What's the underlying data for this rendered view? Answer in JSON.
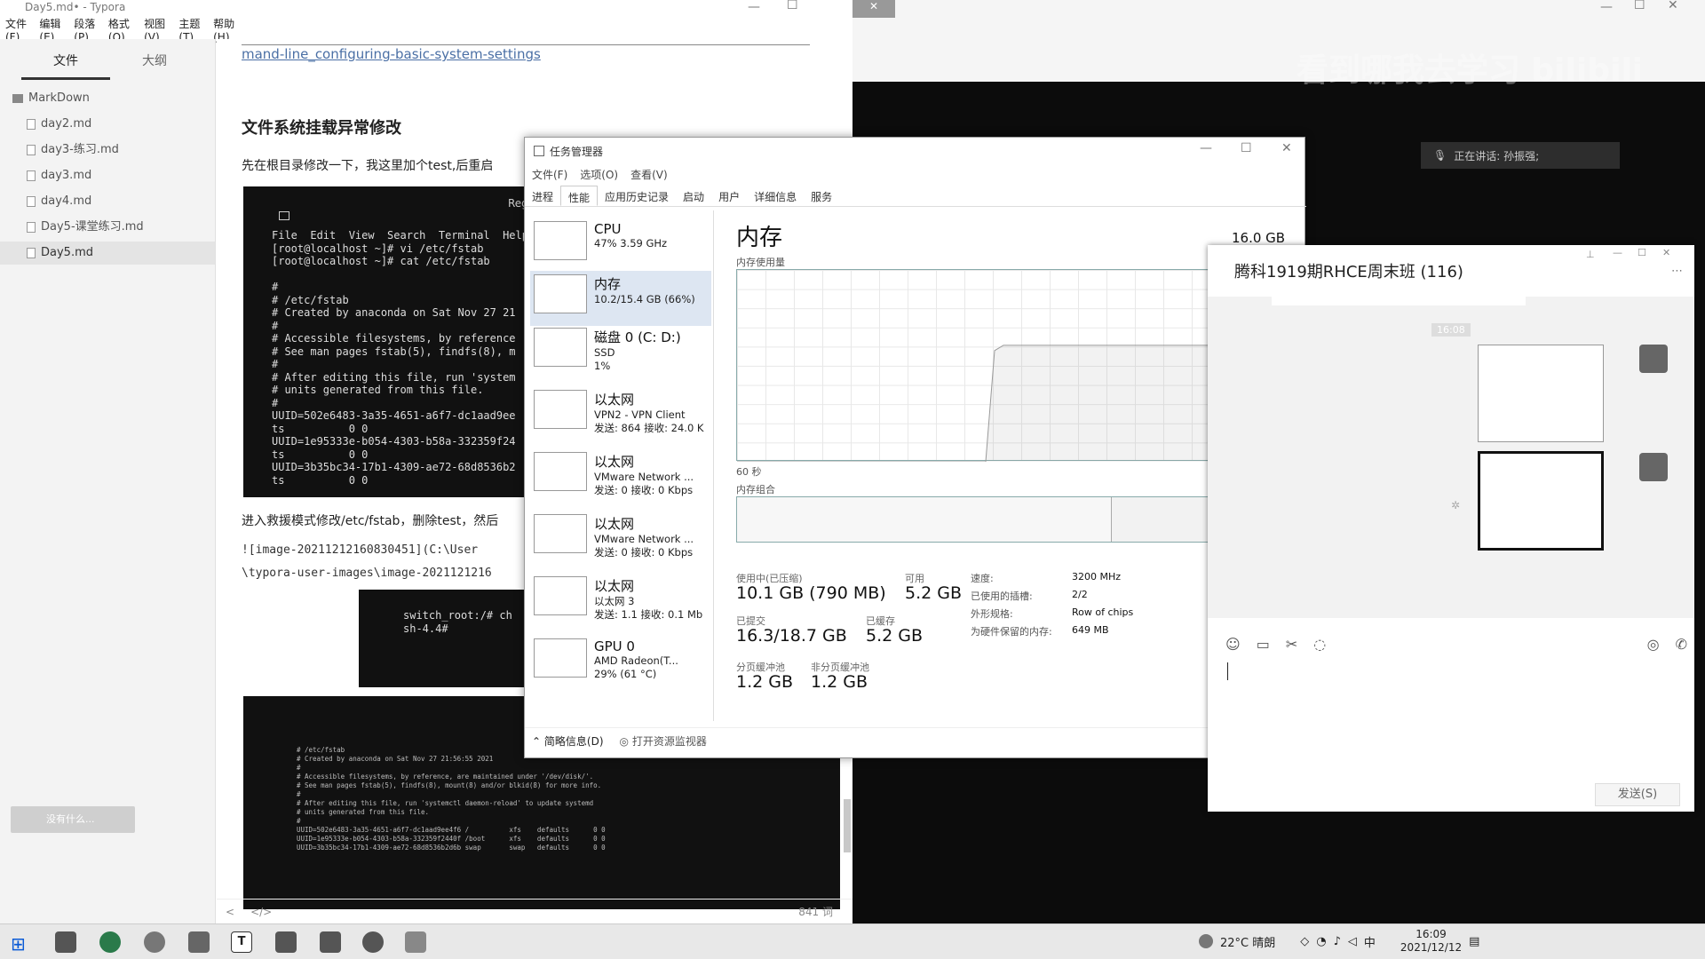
{
  "typora": {
    "title": "Day5.md• - Typora",
    "menu": [
      "文件(F)",
      "编辑(E)",
      "段落(P)",
      "格式(O)",
      "视图(V)",
      "主题(T)",
      "帮助(H)"
    ],
    "sidebar_tabs": [
      "文件",
      "大纲"
    ],
    "folder": "MarkDown",
    "files": [
      "day2.md",
      "day3-练习.md",
      "day3.md",
      "day4.md",
      "Day5-课堂练习.md",
      "Day5.md"
    ],
    "link_text": "mand-line_configuring-basic-system-settings",
    "heading": "文件系统挂载异常修改",
    "para1": "先在根目录修改一下，我这里加个test,后重启",
    "term1": "File  Edit  View  Search  Terminal  Help\n[root@localhost ~]# vi /etc/fstab\n[root@localhost ~]# cat /etc/fstab\n\n#\n# /etc/fstab\n# Created by anaconda on Sat Nov 27 21\n#\n# Accessible filesystems, by reference\n# See man pages fstab(5), findfs(8), m\n#\n# After editing this file, run 'system\n# units generated from this file.\n#\nUUID=502e6483-3a35-4651-a6f7-dc1aad9ee\nts          0 0\nUUID=1e95333e-b054-4303-b58a-332359f24\nts          0 0\nUUID=3b35bc34-17b1-4309-ae72-68d8536b2\nts          0 0",
    "term1_regist": "Regist",
    "para2": "进入救援模式修改/etc/fstab，删除test，然后",
    "img_line1": "![image-20211212160830451](C:\\User",
    "img_line2": "\\typora-user-images\\image-2021121216",
    "term2": "switch_root:/# ch\nsh-4.4#",
    "term3": "# /etc/fstab\n# Created by anaconda on Sat Nov 27 21:56:55 2021\n#\n# Accessible filesystems, by reference, are maintained under '/dev/disk/'.\n# See man pages fstab(5), findfs(8), mount(8) and/or blkid(8) for more info.\n#\n# After editing this file, run 'systemctl daemon-reload' to update systemd\n# units generated from this file.\n#\nUUID=502e6483-3a35-4651-a6f7-dc1aad9ee4f6 /          xfs    defaults      0 0\nUUID=1e95333e-b054-4303-b58a-332359f2440f /boot      xfs    defaults      0 0\nUUID=3b35bc34-17b1-4309-ae72-68d8536b2d6b swap       swap   defaults      0 0",
    "word_count": "841 词",
    "status_left": "<",
    "status_code": "</>",
    "overlay_btn": "没有什么..."
  },
  "browser": {
    "watermark": "看到哪我去学习 bilibili",
    "speaking": "正在讲话: 孙振强;"
  },
  "taskmgr": {
    "title": "任务管理器",
    "menu": [
      "文件(F)",
      "选项(O)",
      "查看(V)"
    ],
    "tabs": [
      "进程",
      "性能",
      "应用历史记录",
      "启动",
      "用户",
      "详细信息",
      "服务"
    ],
    "items": [
      {
        "name": "CPU",
        "sub1": "47% 3.59 GHz",
        "sub2": ""
      },
      {
        "name": "内存",
        "sub1": "10.2/15.4 GB (66%)",
        "sub2": ""
      },
      {
        "name": "磁盘 0 (C: D:)",
        "sub1": "SSD",
        "sub2": "1%"
      },
      {
        "name": "以太网",
        "sub1": "VPN2 - VPN Client",
        "sub2": "发送: 864 接收: 24.0 K"
      },
      {
        "name": "以太网",
        "sub1": "VMware Network ...",
        "sub2": "发送: 0 接收: 0 Kbps"
      },
      {
        "name": "以太网",
        "sub1": "VMware Network ...",
        "sub2": "发送: 0 接收: 0 Kbps"
      },
      {
        "name": "以太网",
        "sub1": "以太网 3",
        "sub2": "发送: 1.1 接收: 0.1 Mb"
      },
      {
        "name": "GPU 0",
        "sub1": "AMD Radeon(T...",
        "sub2": "29% (61 °C)"
      }
    ],
    "mem_title": "内存",
    "mem_total": "16.0 GB",
    "mem_usage_label": "内存使用量",
    "time_label": "60 秒",
    "comp_label": "内存组合",
    "in_use_label": "使用中(已压缩)",
    "in_use": "10.1 GB (790 MB)",
    "avail_label": "可用",
    "avail": "5.2 GB",
    "committed_label": "已提交",
    "committed": "16.3/18.7 GB",
    "cached_label": "已缓存",
    "cached": "5.2 GB",
    "paged_label": "分页缓冲池",
    "paged": "1.2 GB",
    "nonpaged_label": "非分页缓冲池",
    "nonpaged": "1.2 GB",
    "speed_label": "速度:",
    "speed": "3200 MHz",
    "slots_label": "已使用的插槽:",
    "slots": "2/2",
    "form_label": "外形规格:",
    "form": "Row of chips",
    "reserved_label": "为硬件保留的内存:",
    "reserved": "649 MB",
    "foot_less": "简略信息(D)",
    "foot_open": "打开资源监视器",
    "mem_usage_fraction": 0.66
  },
  "chat": {
    "title": "腾科1919期RHCE周末班 (116)",
    "time": "16:08",
    "send": "发送(S)"
  },
  "taskbar": {
    "weather": "22°C 晴朗",
    "ime": "中",
    "time": "16:09",
    "date": "2021/12/12"
  }
}
